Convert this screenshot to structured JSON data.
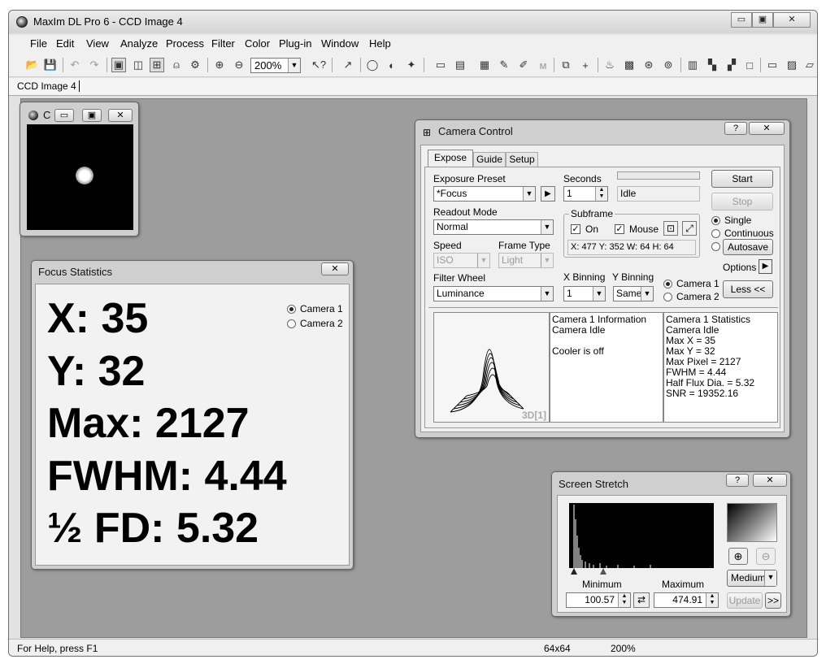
{
  "app": {
    "title": "MaxIm DL Pro 6 - CCD Image 4",
    "caption_min": "▭",
    "caption_max": "▣",
    "caption_close": "✕"
  },
  "menu": [
    "File",
    "Edit",
    "View",
    "Analyze",
    "Process",
    "Filter",
    "Color",
    "Plug-in",
    "Window",
    "Help"
  ],
  "toolbar": {
    "zoom": "200%",
    "icons": [
      "open-icon",
      "save-icon",
      "undo-icon",
      "redo-icon",
      "image-icon",
      "stretch-icon",
      "camera-icon",
      "stamp-icon",
      "settings-icon",
      "zoom-in-icon",
      "zoom-out-icon"
    ]
  },
  "tab": {
    "label": "CCD Image 4"
  },
  "status": {
    "help": "For Help, press F1",
    "size": "64x64",
    "zoom": "200%"
  },
  "image_window": {
    "title": "C"
  },
  "focus_stats": {
    "title": "Focus Statistics",
    "x": "X: 35",
    "y": "Y: 32",
    "max": "Max: 2127",
    "fwhm": "FWHM: 4.44",
    "fd": "½ FD: 5.32",
    "camera1": "Camera 1",
    "camera2": "Camera 2"
  },
  "camera_control": {
    "title": "Camera Control",
    "help": "?",
    "close": "✕",
    "tabs": [
      "Expose",
      "Guide",
      "Setup"
    ],
    "exposure_preset_label": "Exposure Preset",
    "exposure_preset": "*Focus",
    "seconds_label": "Seconds",
    "seconds": "1",
    "status": "Idle",
    "readout_label": "Readout Mode",
    "readout": "Normal",
    "subframe_label": "Subframe",
    "on_label": "On",
    "mouse_label": "Mouse",
    "subframe_value": "X: 477 Y: 352 W:  64 H:  64",
    "speed_label": "Speed",
    "speed": "ISO",
    "frame_type_label": "Frame Type",
    "frame_type": "Light",
    "filter_label": "Filter Wheel",
    "filter": "Luminance",
    "xbin_label": "X Binning",
    "xbin": "1",
    "ybin_label": "Y Binning",
    "ybin": "Same",
    "camera1": "Camera 1",
    "camera2": "Camera 2",
    "start": "Start",
    "stop": "Stop",
    "single": "Single",
    "continuous": "Continuous",
    "autosave": "Autosave",
    "options": "Options",
    "less": "Less <<",
    "plot_label": "3D[1]",
    "info_title": "Camera 1 Information",
    "info_lines": "Camera Idle\n\nCooler is off",
    "stats_title": "Camera 1 Statistics",
    "stats_lines": "Camera Idle\nMax X = 35\nMax Y = 32\nMax Pixel = 2127\nFWHM = 4.44\nHalf Flux Dia. = 5.32\nSNR = 19352.16"
  },
  "screen_stretch": {
    "title": "Screen Stretch",
    "help": "?",
    "close": "✕",
    "minimum_label": "Minimum",
    "maximum_label": "Maximum",
    "minimum": "100.57",
    "maximum": "474.91",
    "mode": "Medium",
    "update": "Update",
    "more": ">>"
  }
}
